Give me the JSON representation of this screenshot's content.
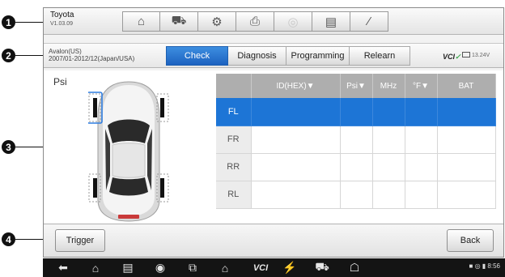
{
  "callouts": [
    "1",
    "2",
    "3",
    "4"
  ],
  "vehicle": {
    "make": "Toyota",
    "version": "V1.03.09"
  },
  "toolbar": {
    "buttons": [
      {
        "icon": "home-icon",
        "glyph": "⌂",
        "disabled": false
      },
      {
        "icon": "vehicle-swap-icon",
        "glyph": "⛟",
        "disabled": false
      },
      {
        "icon": "settings-gear-icon",
        "glyph": "⚙",
        "disabled": false
      },
      {
        "icon": "print-icon",
        "glyph": "⎙",
        "disabled": false
      },
      {
        "icon": "help-icon",
        "glyph": "◎",
        "disabled": true
      },
      {
        "icon": "save-icon",
        "glyph": "▤",
        "disabled": false
      },
      {
        "icon": "edit-pen-icon",
        "glyph": "⁄",
        "disabled": false
      }
    ]
  },
  "model": {
    "line1": "Avalon(US)",
    "line2": "2007/01-2012/12(Japan/USA)"
  },
  "tabs": [
    {
      "label": "Check",
      "active": true
    },
    {
      "label": "Diagnosis",
      "active": false
    },
    {
      "label": "Programming",
      "active": false
    },
    {
      "label": "Relearn",
      "active": false
    }
  ],
  "status": {
    "vci": "VCI",
    "voltage": "13.24V"
  },
  "main": {
    "unit_label": "Psi"
  },
  "table": {
    "headers": [
      "",
      "ID(HEX)▼",
      "Psi▼",
      "MHz",
      "°F▼",
      "BAT"
    ],
    "rows": [
      {
        "pos": "FL",
        "selected": true
      },
      {
        "pos": "FR",
        "selected": false
      },
      {
        "pos": "RR",
        "selected": false
      },
      {
        "pos": "RL",
        "selected": false
      }
    ]
  },
  "buttons": {
    "trigger": "Trigger",
    "back": "Back"
  },
  "nav": {
    "vci_label": "VCI",
    "time": "8:56",
    "icons": [
      "back-icon",
      "home-icon",
      "recent-apps-icon",
      "browser-icon",
      "screen-switch-icon",
      "autel-home-icon",
      "vci-icon",
      "connection-icon",
      "vehicle-icon",
      "garage-icon"
    ]
  }
}
